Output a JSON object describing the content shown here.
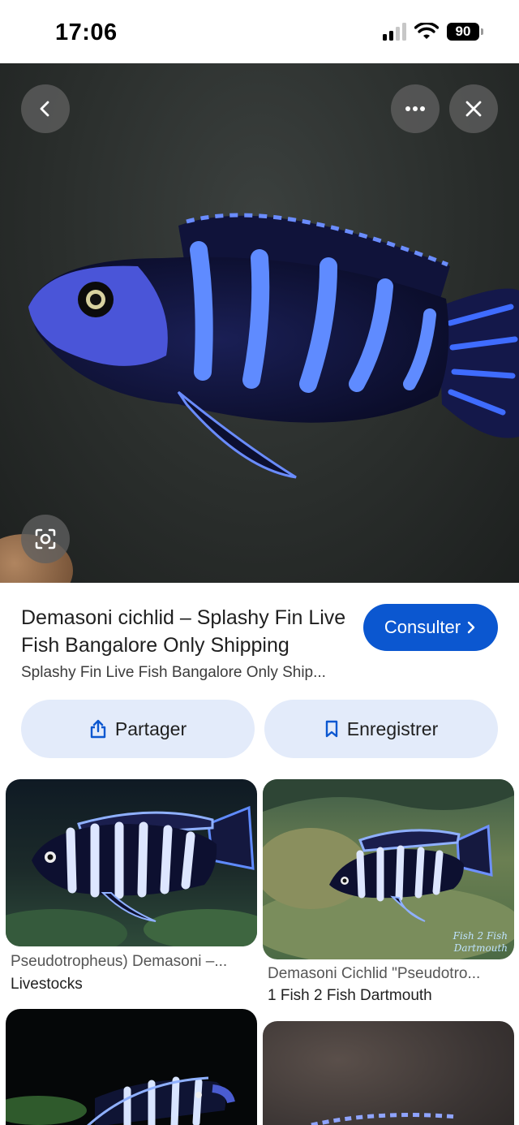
{
  "status": {
    "time": "17:06",
    "battery": "90"
  },
  "hero": {
    "icons": [
      "back-arrow-icon",
      "more-dots-icon",
      "close-icon",
      "lens-icon"
    ]
  },
  "result": {
    "title": "Demasoni cichlid – Splashy Fin Live Fish Bangalore Only Shipping",
    "subtitle": "Splashy Fin Live Fish Bangalore Only Ship...",
    "visit_label": "Consulter",
    "share_label": "Partager",
    "save_label": "Enregistrer"
  },
  "related": [
    {
      "caption": "Pseudotropheus) Demasoni –...",
      "source": "Livestocks"
    },
    {
      "caption": "Demasoni Cichlid \"Pseudotro...",
      "source": "1 Fish 2 Fish Dartmouth",
      "watermark": "Fish 2 Fish Dartmouth"
    },
    {
      "caption": "",
      "source": ""
    },
    {
      "caption": "",
      "source": ""
    }
  ],
  "colors": {
    "accent": "#0b57d0",
    "pill_bg": "#e3ebfa",
    "fish_blue": "#3d6cff"
  }
}
